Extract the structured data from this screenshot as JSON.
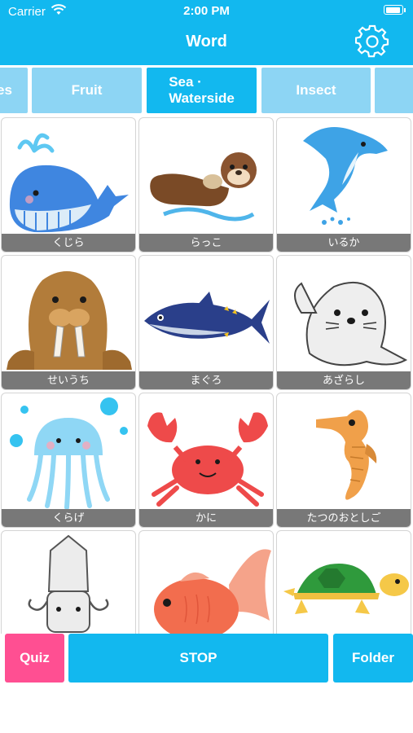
{
  "status_bar": {
    "carrier": "Carrier",
    "time": "2:00 PM"
  },
  "header": {
    "title": "Word",
    "settings_icon": "gear-icon"
  },
  "tabs": [
    {
      "label": "es",
      "active": false
    },
    {
      "label": "Fruit",
      "active": false
    },
    {
      "label": "Sea ·\nWaterside",
      "active": true
    },
    {
      "label": "Insect",
      "active": false
    },
    {
      "label": "",
      "active": false
    }
  ],
  "cards": [
    {
      "label": "くじら",
      "icon": "whale-icon"
    },
    {
      "label": "らっこ",
      "icon": "otter-icon"
    },
    {
      "label": "いるか",
      "icon": "dolphin-icon"
    },
    {
      "label": "せいうち",
      "icon": "walrus-icon"
    },
    {
      "label": "まぐろ",
      "icon": "tuna-icon"
    },
    {
      "label": "あざらし",
      "icon": "seal-icon"
    },
    {
      "label": "くらげ",
      "icon": "jellyfish-icon"
    },
    {
      "label": "かに",
      "icon": "crab-icon"
    },
    {
      "label": "たつのおとしご",
      "icon": "seahorse-icon"
    },
    {
      "label": "",
      "icon": "squid-icon"
    },
    {
      "label": "",
      "icon": "goldfish-icon"
    },
    {
      "label": "",
      "icon": "turtle-icon"
    }
  ],
  "buttons": {
    "quiz": "Quiz",
    "stop": "STOP",
    "folder": "Folder"
  },
  "colors": {
    "primary": "#12b8ef",
    "tab_inactive": "#8dd5f4",
    "quiz": "#ff4f92"
  }
}
